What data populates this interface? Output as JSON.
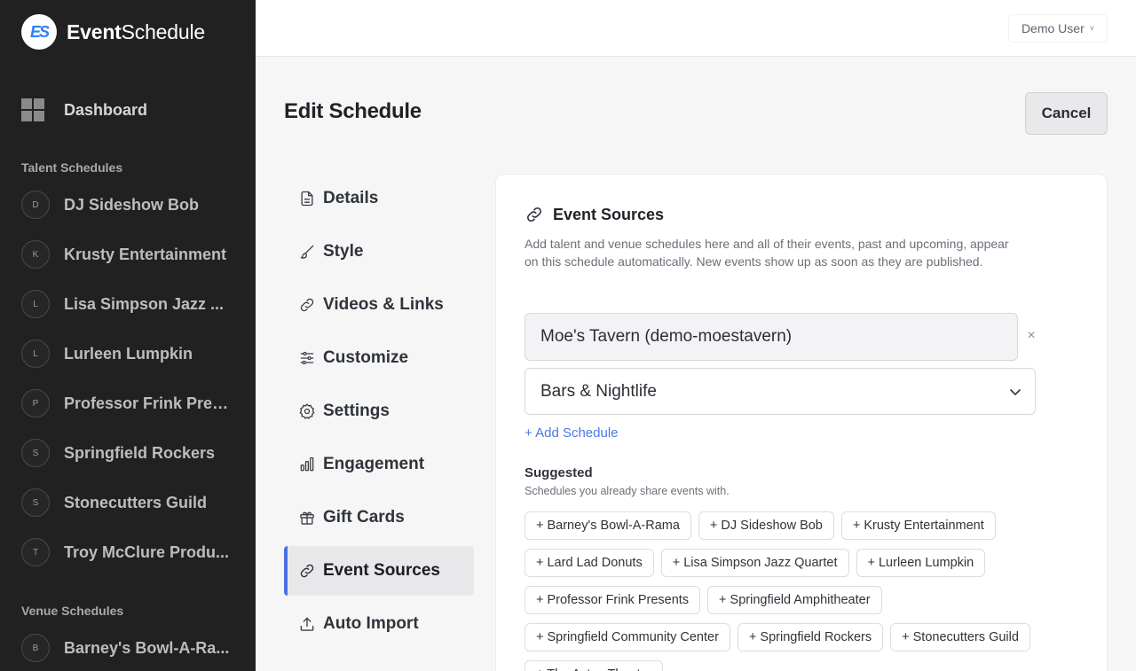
{
  "app": {
    "logo_badge": "ES",
    "name_bold": "Event",
    "name_regular": "Schedule",
    "brand_color": "#2d7ff9",
    "accent_color": "#4f6fe6"
  },
  "sidebar": {
    "dashboard_label": "Dashboard",
    "talent_title": "Talent Schedules",
    "talent": [
      {
        "initial": "D",
        "name": "DJ Sideshow Bob"
      },
      {
        "initial": "K",
        "name": "Krusty Entertainment"
      },
      {
        "initial": "L",
        "name": "Lisa Simpson Jazz ..."
      },
      {
        "initial": "L",
        "name": "Lurleen Lumpkin"
      },
      {
        "initial": "P",
        "name": "Professor Frink Pres..."
      },
      {
        "initial": "S",
        "name": "Springfield Rockers"
      },
      {
        "initial": "S",
        "name": "Stonecutters Guild"
      },
      {
        "initial": "T",
        "name": "Troy McClure Produ..."
      }
    ],
    "venue_title": "Venue Schedules",
    "venues": [
      {
        "initial": "B",
        "name": "Barney's Bowl-A-Ra..."
      }
    ]
  },
  "header": {
    "user_name": "Demo User",
    "user_chevron": "˅"
  },
  "page": {
    "title": "Edit Schedule",
    "cancel_label": "Cancel"
  },
  "subnav": [
    {
      "label": "Details",
      "icon": "document-icon"
    },
    {
      "label": "Style",
      "icon": "brush-icon"
    },
    {
      "label": "Videos & Links",
      "icon": "link-icon"
    },
    {
      "label": "Customize",
      "icon": "sliders-icon"
    },
    {
      "label": "Settings",
      "icon": "gear-icon"
    },
    {
      "label": "Engagement",
      "icon": "bar-chart-icon"
    },
    {
      "label": "Gift Cards",
      "icon": "gift-icon"
    },
    {
      "label": "Event Sources",
      "icon": "link-icon",
      "active": true
    },
    {
      "label": "Auto Import",
      "icon": "upload-icon"
    }
  ],
  "card": {
    "title": "Event Sources",
    "description": "Add talent and venue schedules here and all of their events, past and upcoming, appear on this schedule automatically. New events show up as soon as they are published.",
    "source_value": "Moe's Tavern (demo-moestavern)",
    "remove_label": "×",
    "category_value": "Bars & Nightlife",
    "add_label": "+ Add Schedule",
    "suggested_title": "Suggested",
    "suggested_sub": "Schedules you already share events with.",
    "suggestions": [
      "+ Barney's Bowl-A-Rama",
      "+ DJ Sideshow Bob",
      "+ Krusty Entertainment",
      "+ Lard Lad Donuts",
      "+ Lisa Simpson Jazz Quartet",
      "+ Lurleen Lumpkin",
      "+ Professor Frink Presents",
      "+ Springfield Amphitheater",
      "+ Springfield Community Center",
      "+ Springfield Rockers",
      "+ Stonecutters Guild",
      "+ The Aztec Theater"
    ]
  }
}
